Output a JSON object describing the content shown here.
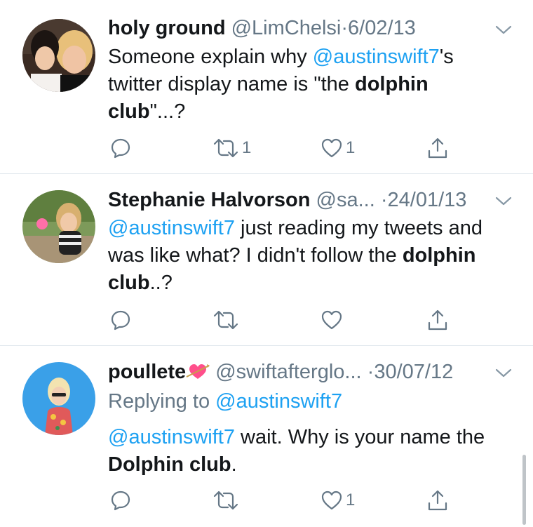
{
  "tweets": [
    {
      "display_name": "holy ground",
      "handle": "@LimChelsi",
      "date": "6/02/13",
      "text_1": "Someone explain why ",
      "mention_1": "@austinswift7",
      "text_2": "'s twitter display name is \"the ",
      "bold_1": "dolphin club",
      "text_3": "\"...?",
      "reply_count": "",
      "retweet_count": "1",
      "like_count": "1"
    },
    {
      "display_name": "Stephanie Halvorson",
      "handle": "@sa...",
      "date": "24/01/13",
      "mention_1": "@austinswift7",
      "text_1": " just reading my tweets and was like what? I didn't follow the ",
      "bold_1": "dolphin club",
      "text_2": "..?",
      "reply_count": "",
      "retweet_count": "",
      "like_count": ""
    },
    {
      "display_name": "poullete",
      "emoji": "💘",
      "handle": "@swiftafterglo...",
      "date": "30/07/12",
      "replying_label": "Replying to ",
      "replying_to": "@austinswift7",
      "mention_1": "@austinswift7",
      "text_1": " wait. Why is your name the ",
      "bold_1": "Dolphin club",
      "text_2": ".",
      "reply_count": "",
      "retweet_count": "",
      "like_count": "1"
    }
  ],
  "separator": "·",
  "colors": {
    "link": "#1da1f2",
    "secondary_text": "#657786",
    "primary_text": "#14171a",
    "divider": "#e1e8ed"
  },
  "icons": [
    "reply-icon",
    "retweet-icon",
    "like-icon",
    "share-icon",
    "chevron-down-icon",
    "heart-arrow-emoji"
  ]
}
